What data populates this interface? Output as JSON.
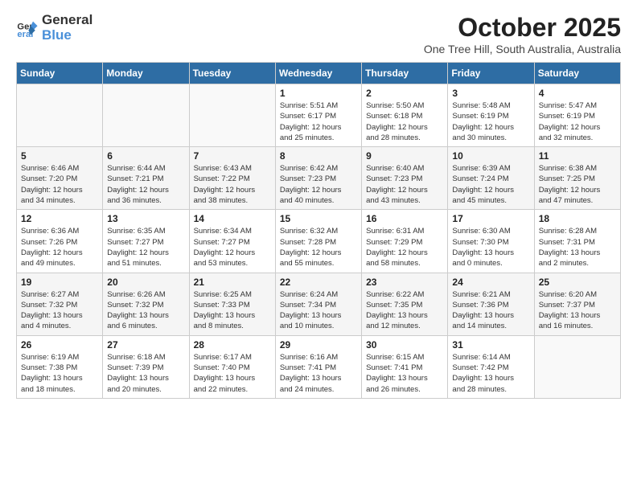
{
  "header": {
    "logo_general": "General",
    "logo_blue": "Blue",
    "month": "October 2025",
    "location": "One Tree Hill, South Australia, Australia"
  },
  "calendar": {
    "weekdays": [
      "Sunday",
      "Monday",
      "Tuesday",
      "Wednesday",
      "Thursday",
      "Friday",
      "Saturday"
    ],
    "weeks": [
      [
        {
          "day": "",
          "info": ""
        },
        {
          "day": "",
          "info": ""
        },
        {
          "day": "",
          "info": ""
        },
        {
          "day": "1",
          "info": "Sunrise: 5:51 AM\nSunset: 6:17 PM\nDaylight: 12 hours\nand 25 minutes."
        },
        {
          "day": "2",
          "info": "Sunrise: 5:50 AM\nSunset: 6:18 PM\nDaylight: 12 hours\nand 28 minutes."
        },
        {
          "day": "3",
          "info": "Sunrise: 5:48 AM\nSunset: 6:19 PM\nDaylight: 12 hours\nand 30 minutes."
        },
        {
          "day": "4",
          "info": "Sunrise: 5:47 AM\nSunset: 6:19 PM\nDaylight: 12 hours\nand 32 minutes."
        }
      ],
      [
        {
          "day": "5",
          "info": "Sunrise: 6:46 AM\nSunset: 7:20 PM\nDaylight: 12 hours\nand 34 minutes."
        },
        {
          "day": "6",
          "info": "Sunrise: 6:44 AM\nSunset: 7:21 PM\nDaylight: 12 hours\nand 36 minutes."
        },
        {
          "day": "7",
          "info": "Sunrise: 6:43 AM\nSunset: 7:22 PM\nDaylight: 12 hours\nand 38 minutes."
        },
        {
          "day": "8",
          "info": "Sunrise: 6:42 AM\nSunset: 7:23 PM\nDaylight: 12 hours\nand 40 minutes."
        },
        {
          "day": "9",
          "info": "Sunrise: 6:40 AM\nSunset: 7:23 PM\nDaylight: 12 hours\nand 43 minutes."
        },
        {
          "day": "10",
          "info": "Sunrise: 6:39 AM\nSunset: 7:24 PM\nDaylight: 12 hours\nand 45 minutes."
        },
        {
          "day": "11",
          "info": "Sunrise: 6:38 AM\nSunset: 7:25 PM\nDaylight: 12 hours\nand 47 minutes."
        }
      ],
      [
        {
          "day": "12",
          "info": "Sunrise: 6:36 AM\nSunset: 7:26 PM\nDaylight: 12 hours\nand 49 minutes."
        },
        {
          "day": "13",
          "info": "Sunrise: 6:35 AM\nSunset: 7:27 PM\nDaylight: 12 hours\nand 51 minutes."
        },
        {
          "day": "14",
          "info": "Sunrise: 6:34 AM\nSunset: 7:27 PM\nDaylight: 12 hours\nand 53 minutes."
        },
        {
          "day": "15",
          "info": "Sunrise: 6:32 AM\nSunset: 7:28 PM\nDaylight: 12 hours\nand 55 minutes."
        },
        {
          "day": "16",
          "info": "Sunrise: 6:31 AM\nSunset: 7:29 PM\nDaylight: 12 hours\nand 58 minutes."
        },
        {
          "day": "17",
          "info": "Sunrise: 6:30 AM\nSunset: 7:30 PM\nDaylight: 13 hours\nand 0 minutes."
        },
        {
          "day": "18",
          "info": "Sunrise: 6:28 AM\nSunset: 7:31 PM\nDaylight: 13 hours\nand 2 minutes."
        }
      ],
      [
        {
          "day": "19",
          "info": "Sunrise: 6:27 AM\nSunset: 7:32 PM\nDaylight: 13 hours\nand 4 minutes."
        },
        {
          "day": "20",
          "info": "Sunrise: 6:26 AM\nSunset: 7:32 PM\nDaylight: 13 hours\nand 6 minutes."
        },
        {
          "day": "21",
          "info": "Sunrise: 6:25 AM\nSunset: 7:33 PM\nDaylight: 13 hours\nand 8 minutes."
        },
        {
          "day": "22",
          "info": "Sunrise: 6:24 AM\nSunset: 7:34 PM\nDaylight: 13 hours\nand 10 minutes."
        },
        {
          "day": "23",
          "info": "Sunrise: 6:22 AM\nSunset: 7:35 PM\nDaylight: 13 hours\nand 12 minutes."
        },
        {
          "day": "24",
          "info": "Sunrise: 6:21 AM\nSunset: 7:36 PM\nDaylight: 13 hours\nand 14 minutes."
        },
        {
          "day": "25",
          "info": "Sunrise: 6:20 AM\nSunset: 7:37 PM\nDaylight: 13 hours\nand 16 minutes."
        }
      ],
      [
        {
          "day": "26",
          "info": "Sunrise: 6:19 AM\nSunset: 7:38 PM\nDaylight: 13 hours\nand 18 minutes."
        },
        {
          "day": "27",
          "info": "Sunrise: 6:18 AM\nSunset: 7:39 PM\nDaylight: 13 hours\nand 20 minutes."
        },
        {
          "day": "28",
          "info": "Sunrise: 6:17 AM\nSunset: 7:40 PM\nDaylight: 13 hours\nand 22 minutes."
        },
        {
          "day": "29",
          "info": "Sunrise: 6:16 AM\nSunset: 7:41 PM\nDaylight: 13 hours\nand 24 minutes."
        },
        {
          "day": "30",
          "info": "Sunrise: 6:15 AM\nSunset: 7:41 PM\nDaylight: 13 hours\nand 26 minutes."
        },
        {
          "day": "31",
          "info": "Sunrise: 6:14 AM\nSunset: 7:42 PM\nDaylight: 13 hours\nand 28 minutes."
        },
        {
          "day": "",
          "info": ""
        }
      ]
    ]
  }
}
